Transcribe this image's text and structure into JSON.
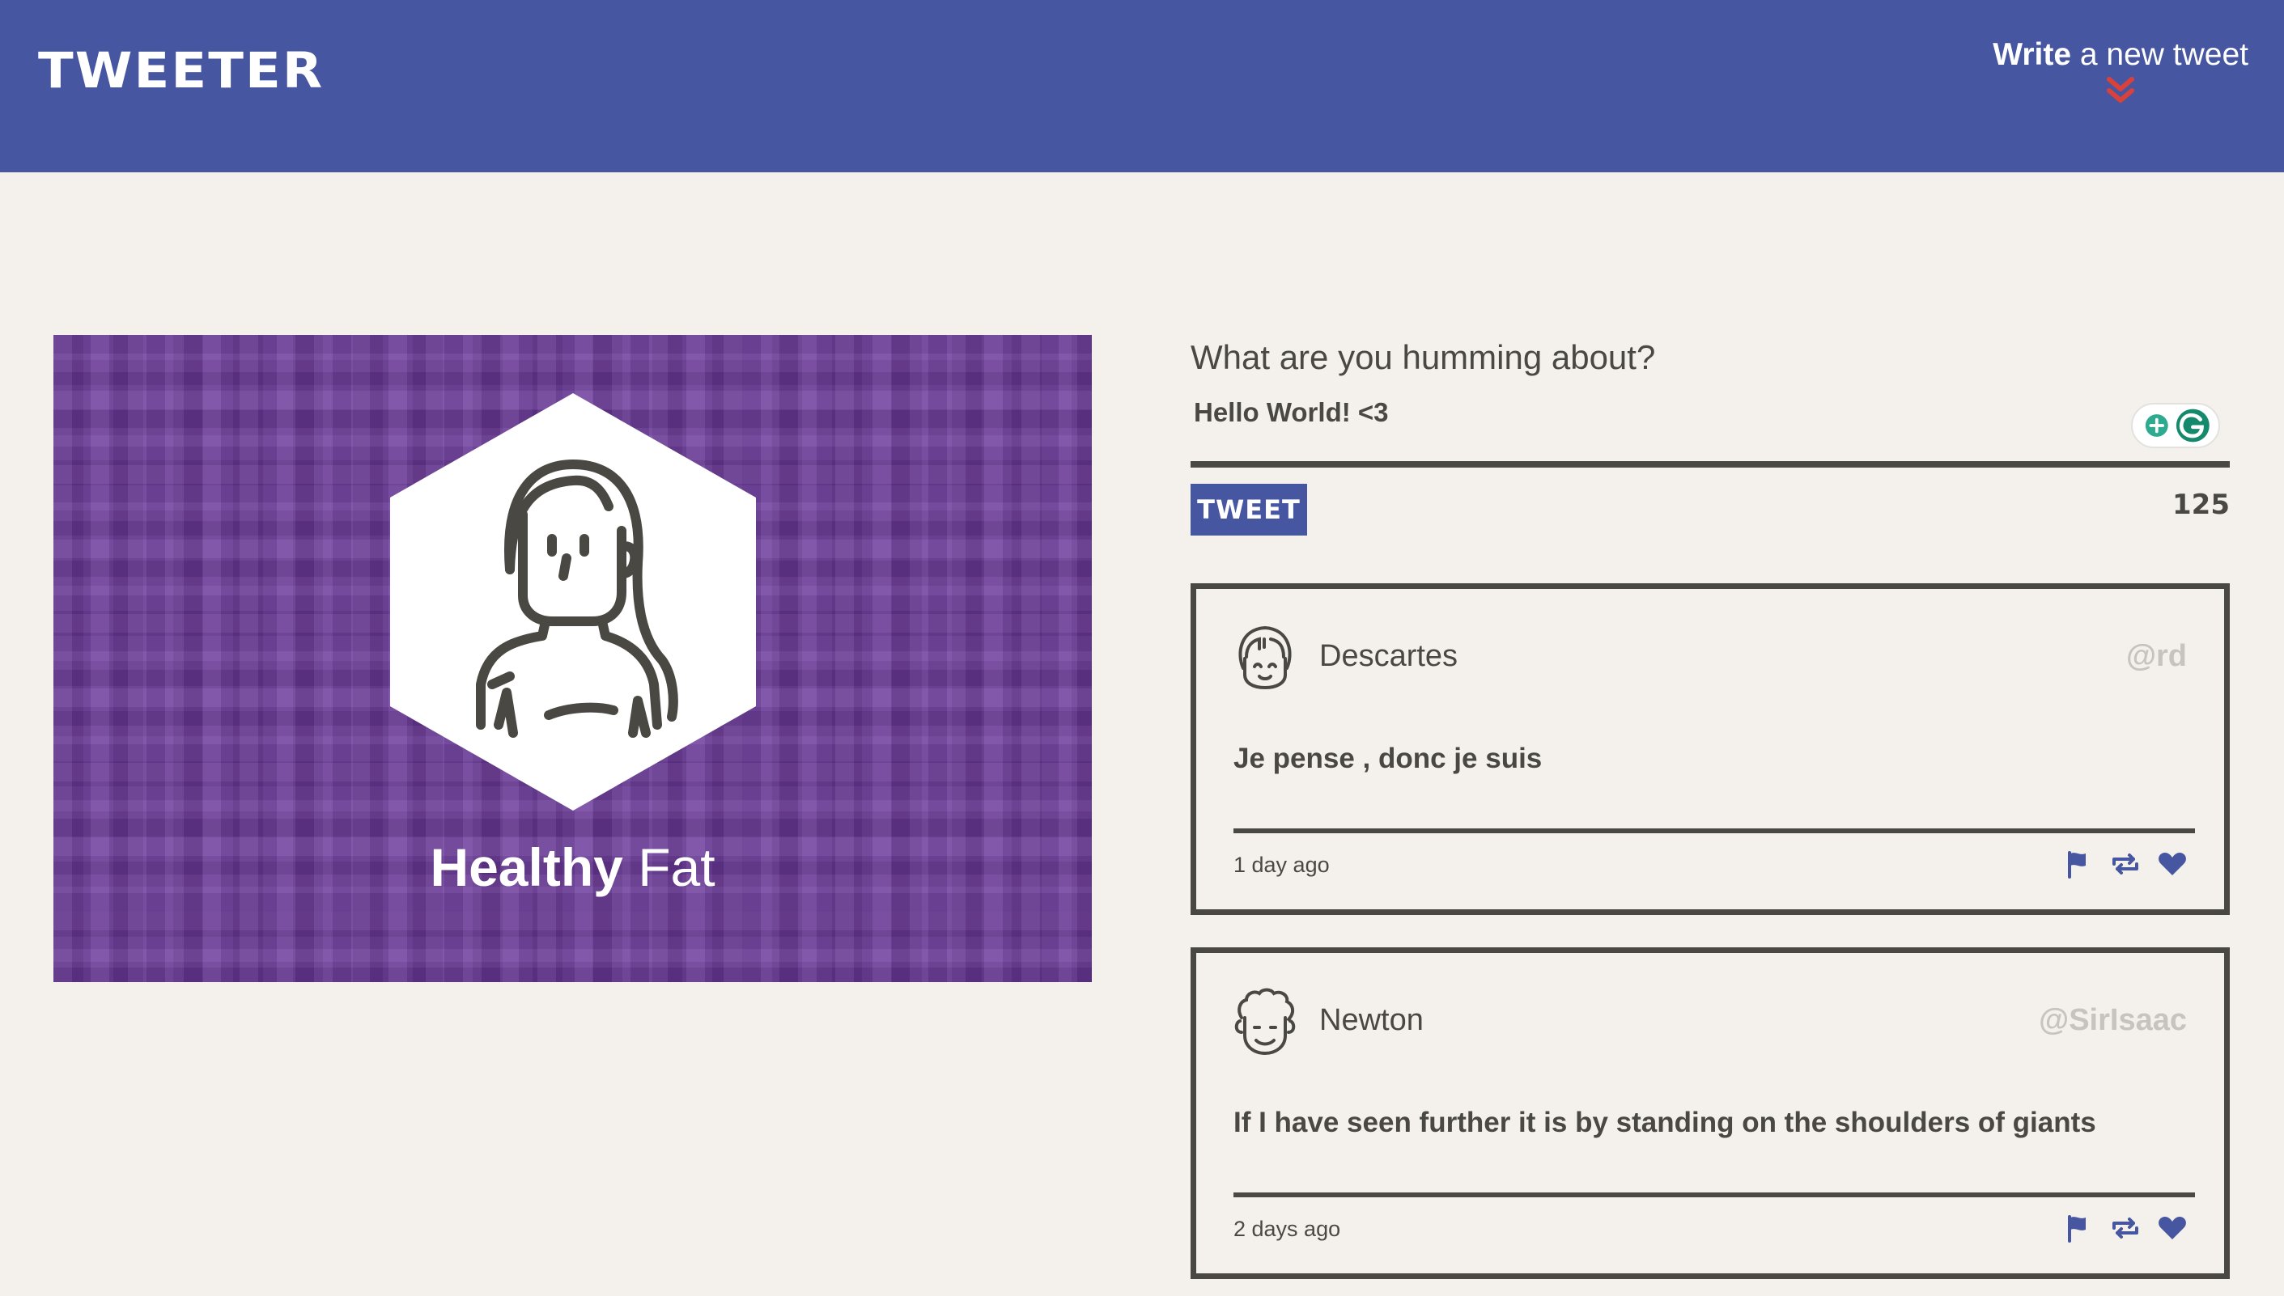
{
  "header": {
    "brand": "TWEETER",
    "compose_toggle_bold": "Write",
    "compose_toggle_rest": " a new tweet",
    "compose_toggle_icon": "double-chevron-down-icon",
    "accent_color": "#4756a0",
    "chevron_color": "#d9423b"
  },
  "profile": {
    "name_first": "Healthy",
    "name_last": " Fat",
    "background_color": "#6c3a9b"
  },
  "compose": {
    "label": "What are you humming about?",
    "input_value": "Hello World! <3",
    "button_label": "TWEET",
    "counter": "125"
  },
  "tweets": [
    {
      "author": "Descartes",
      "handle": "@rd",
      "content": "Je pense , donc je suis",
      "timestamp": "1 day ago",
      "actions": [
        "flag-icon",
        "retweet-icon",
        "heart-icon"
      ]
    },
    {
      "author": "Newton",
      "handle": "@SirIsaac",
      "content": "If I have seen further it is by standing on the shoulders of giants",
      "timestamp": "2 days ago",
      "actions": [
        "flag-icon",
        "retweet-icon",
        "heart-icon"
      ]
    }
  ]
}
